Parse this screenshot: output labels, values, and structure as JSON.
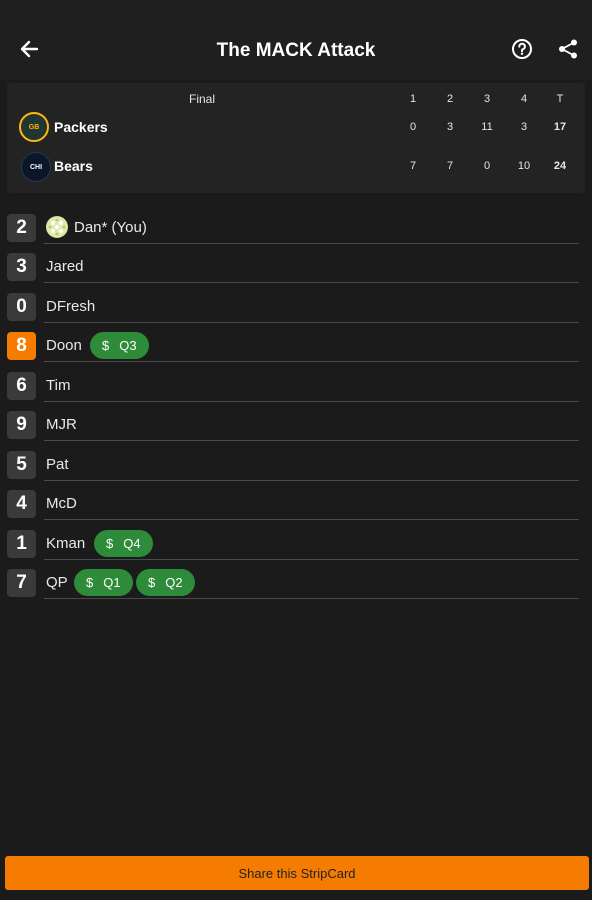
{
  "appbar": {
    "title": "The MACK Attack"
  },
  "scoreboard": {
    "status": "Final",
    "quarters": [
      "1",
      "2",
      "3",
      "4",
      "T"
    ],
    "teams": [
      {
        "abbr": "GB",
        "name": "Packers",
        "scores": [
          "0",
          "3",
          "11",
          "3",
          "17"
        ]
      },
      {
        "abbr": "CHI",
        "name": "Bears",
        "scores": [
          "7",
          "7",
          "0",
          "10",
          "24"
        ]
      }
    ]
  },
  "roster": [
    {
      "number": "2",
      "name": "Dan* (You)",
      "badges": []
    },
    {
      "number": "3",
      "name": "Jared",
      "badges": []
    },
    {
      "number": "0",
      "name": "DFresh",
      "badges": []
    },
    {
      "number": "8",
      "name": "Doon",
      "badges": [
        "Q3"
      ],
      "highlight": true
    },
    {
      "number": "6",
      "name": "Tim",
      "badges": []
    },
    {
      "number": "9",
      "name": "MJR",
      "badges": []
    },
    {
      "number": "5",
      "name": "Pat",
      "badges": []
    },
    {
      "number": "4",
      "name": "McD",
      "badges": []
    },
    {
      "number": "1",
      "name": "Kman",
      "badges": [
        "Q4"
      ]
    },
    {
      "number": "7",
      "name": "QP",
      "badges": [
        "Q1",
        "Q2"
      ]
    }
  ],
  "badge_symbol": "$",
  "share_button": "Share this StripCard",
  "colors": {
    "accent": "#f57c00",
    "win_badge": "#2e8b3a",
    "background": "#1b1b1b"
  }
}
